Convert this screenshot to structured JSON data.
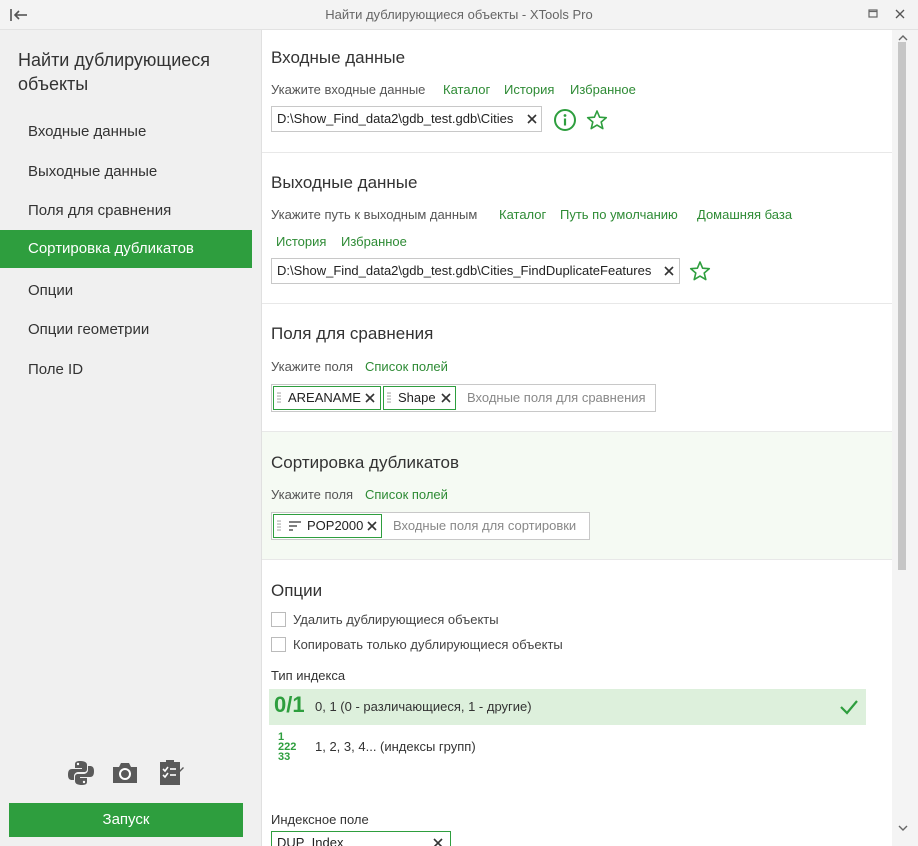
{
  "window": {
    "title": "Найти дублирующиеся объекты - XTools Pro",
    "back_icon": "collapse-left-icon",
    "restore_icon": "restore-icon",
    "close_icon": "close-icon"
  },
  "sidebar": {
    "title": "Найти дублирующиеся объекты",
    "items": [
      {
        "label": "Входные данные",
        "active": false
      },
      {
        "label": "Выходные данные",
        "active": false
      },
      {
        "label": "Поля для сравнения",
        "active": false
      },
      {
        "label": "Сортировка дубликатов",
        "active": true
      },
      {
        "label": "Опции",
        "active": false
      },
      {
        "label": "Опции геометрии",
        "active": false
      },
      {
        "label": "Поле ID",
        "active": false
      }
    ],
    "icons": [
      "python-icon",
      "camera-icon",
      "clipboard-checklist-icon"
    ],
    "run_label": "Запуск"
  },
  "input": {
    "title": "Входные данные",
    "hint": "Укажите входные данные",
    "links": [
      "Каталог",
      "История",
      "Избранное"
    ],
    "path": "D:\\Show_Find_data2\\gdb_test.gdb\\Cities",
    "info_icon": "info-icon",
    "fav_icon": "star-icon"
  },
  "output": {
    "title": "Выходные данные",
    "hint": "Укажите путь к выходным данным",
    "links": [
      "Каталог",
      "Путь по умолчанию",
      "Домашняя база",
      "История",
      "Избранное"
    ],
    "path": "D:\\Show_Find_data2\\gdb_test.gdb\\Cities_FindDuplicateFeatures",
    "fav_icon": "star-icon"
  },
  "compare": {
    "title": "Поля для сравнения",
    "hint": "Укажите поля",
    "link": "Список полей",
    "chips": [
      "AREANAME",
      "Shape"
    ],
    "placeholder": "Входные поля для сравнения"
  },
  "sort": {
    "title": "Сортировка дубликатов",
    "hint": "Укажите поля",
    "link": "Список полей",
    "chips": [
      "POP2000"
    ],
    "sort_icon": "sort-ascending-icon",
    "placeholder": "Входные поля для сортировки"
  },
  "options": {
    "title": "Опции",
    "checkboxes": [
      {
        "label": "Удалить дублирующиеся объекты",
        "checked": false
      },
      {
        "label": "Копировать только дублирующиеся объекты",
        "checked": false
      }
    ],
    "index_type_label": "Тип индекса",
    "index_types": [
      {
        "glyph": "0/1",
        "label": "0, 1 (0 - различающиеся, 1 - другие)",
        "selected": true
      },
      {
        "glyph_lines": [
          "1",
          "222",
          "33"
        ],
        "label": "1, 2, 3, 4... (индексы групп)",
        "selected": false
      }
    ],
    "check_icon": "checkmark-icon",
    "index_field_label": "Индексное поле",
    "index_field_value": "DUP_Index"
  },
  "colors": {
    "accent": "#2e9e3e",
    "link": "#2e8b35",
    "selected_row": "#ddf0dc"
  }
}
